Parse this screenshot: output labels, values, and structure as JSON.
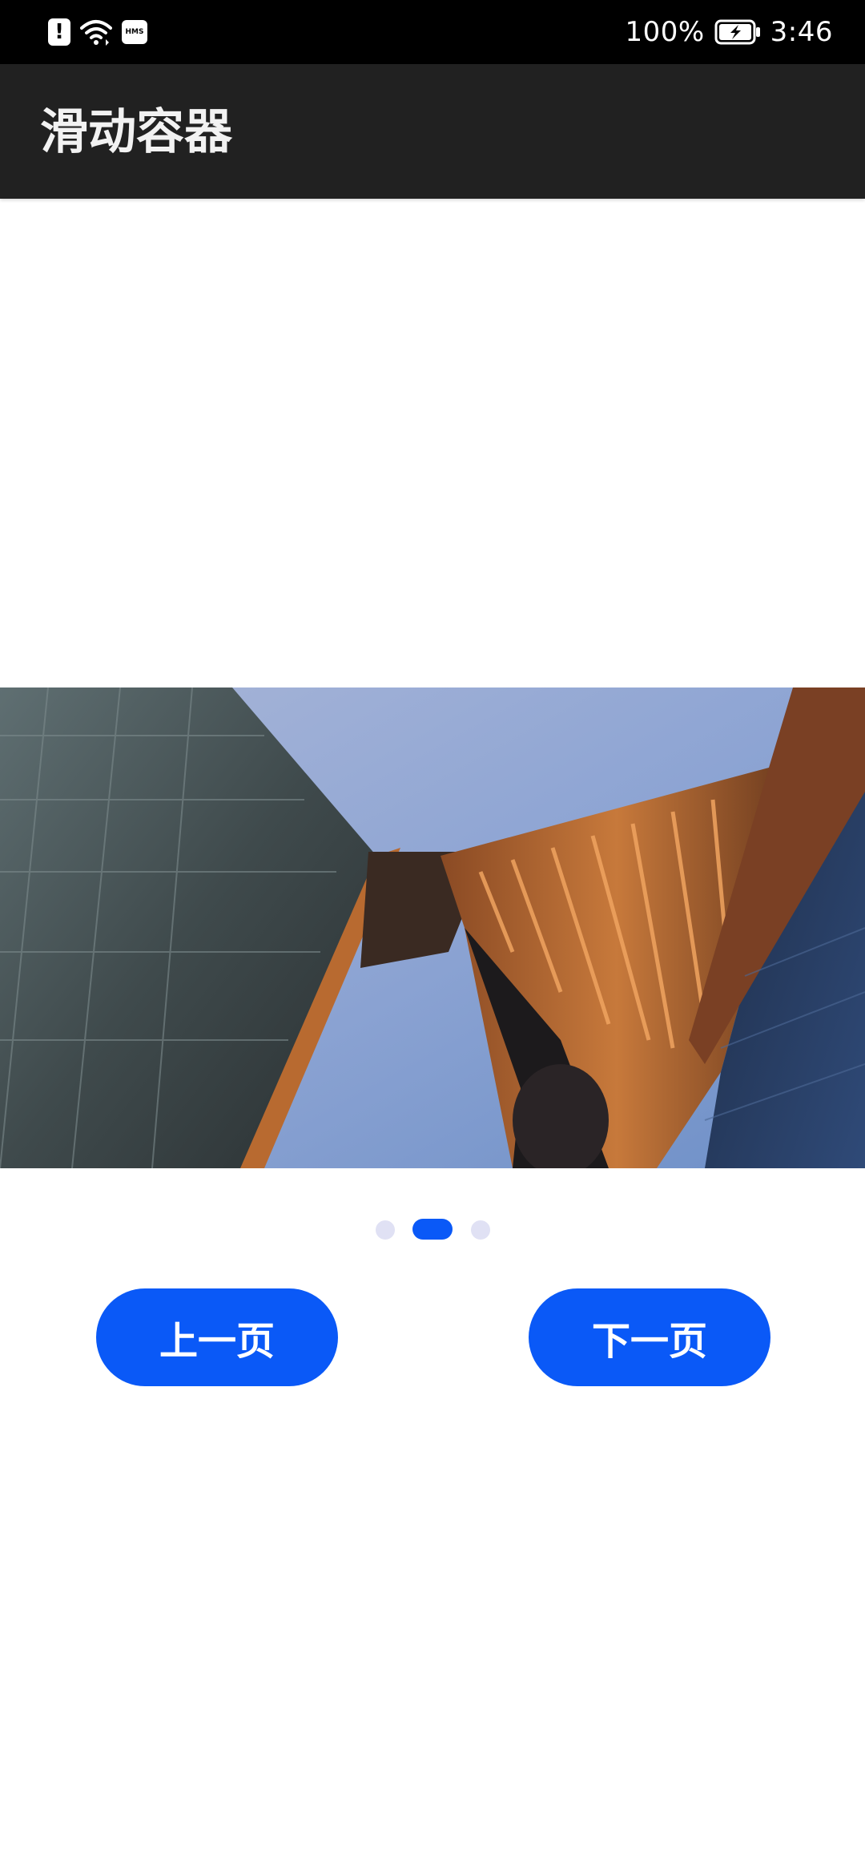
{
  "status_bar": {
    "battery_percent": "100%",
    "time": "3:46",
    "hms_badge": "HMS",
    "icons": [
      "alert-icon",
      "wifi-icon",
      "hms-icon",
      "battery-charging-icon"
    ]
  },
  "app_bar": {
    "title": "滑动容器"
  },
  "carousel": {
    "image_subject": "building-photo",
    "page_count": 3,
    "active_index": 1
  },
  "buttons": {
    "prev_label": "上一页",
    "next_label": "下一页"
  },
  "colors": {
    "accent": "#0a59f7",
    "inactive_dot": "#e0e1f4",
    "app_bar_bg": "#212121",
    "status_bar_bg": "#000000"
  }
}
